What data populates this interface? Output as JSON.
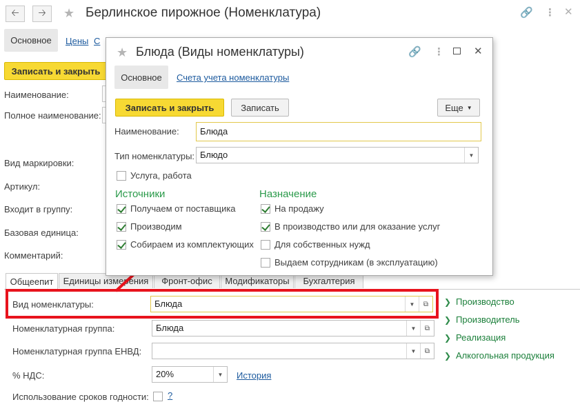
{
  "main_window": {
    "title": "Берлинское пирожное (Номенклатура)",
    "tabs": [
      {
        "label": "Основное",
        "active": true
      },
      {
        "label": "Цены",
        "active": false
      },
      {
        "label": "С",
        "active": false
      }
    ],
    "save_close_label": "Записать и закрыть",
    "labels": {
      "name": "Наименование:",
      "full_name": "Полное наименование:",
      "marking": "Вид маркировки:",
      "article": "Артикул:",
      "group": "Входит в группу:",
      "base_unit": "Базовая единица:",
      "comment": "Комментарий:"
    },
    "bottom_tabs": [
      {
        "label": "Общеепит",
        "active": true
      },
      {
        "label": "Единицы измерения",
        "active": false
      },
      {
        "label": "Фронт-офис",
        "active": false
      },
      {
        "label": "Модификаторы",
        "active": false
      },
      {
        "label": "Бухгалтерия",
        "active": false
      }
    ],
    "fields": {
      "nomenclature_type": {
        "label": "Вид номенклатуры:",
        "value": "Блюда"
      },
      "nomenclature_group": {
        "label": "Номенклатурная группа:",
        "value": "Блюда"
      },
      "envd_group": {
        "label": "Номенклатурная группа ЕНВД:",
        "value": ""
      },
      "vat": {
        "label": "% НДС:",
        "value": "20%",
        "history_link": "История"
      },
      "shelf_life": {
        "label": "Использование сроков годности:",
        "help": "?"
      }
    },
    "side_links": [
      "Производство",
      "Производитель",
      "Реализация",
      "Алкогольная продукция"
    ]
  },
  "dialog": {
    "title": "Блюда (Виды номенклатуры)",
    "tabs": [
      {
        "label": "Основное",
        "active": true
      },
      {
        "label": "Счета учета номенклатуры",
        "active": false
      }
    ],
    "buttons": {
      "save_close": "Записать и закрыть",
      "save": "Записать",
      "more": "Еще"
    },
    "name": {
      "label": "Наименование:",
      "value": "Блюда"
    },
    "type": {
      "label": "Тип номенклатуры:",
      "value": "Блюдо"
    },
    "service": {
      "label": "Услуга, работа",
      "checked": false
    },
    "sources": {
      "title": "Источники",
      "items": [
        {
          "label": "Получаем от поставщика",
          "checked": true
        },
        {
          "label": "Производим",
          "checked": true
        },
        {
          "label": "Собираем из комплектующих",
          "checked": true
        }
      ]
    },
    "purpose": {
      "title": "Назначение",
      "items": [
        {
          "label": "На продажу",
          "checked": true
        },
        {
          "label": "В производство или для оказание услуг",
          "checked": true
        },
        {
          "label": "Для собственных нужд",
          "checked": false
        },
        {
          "label": "Выдаем сотрудникам (в эксплуатацию)",
          "checked": false
        }
      ]
    }
  },
  "icons": {
    "back": "arrow-left-icon",
    "forward": "arrow-right-icon",
    "favorite": "star-icon",
    "link": "link-icon",
    "menu": "more-vertical-icon",
    "maximize": "maximize-icon",
    "close": "close-icon"
  },
  "colors": {
    "accent_yellow": "#f7d933",
    "highlight_red": "#e8131d",
    "section_green": "#2a9a4a",
    "link_blue": "#1c5a9e"
  }
}
